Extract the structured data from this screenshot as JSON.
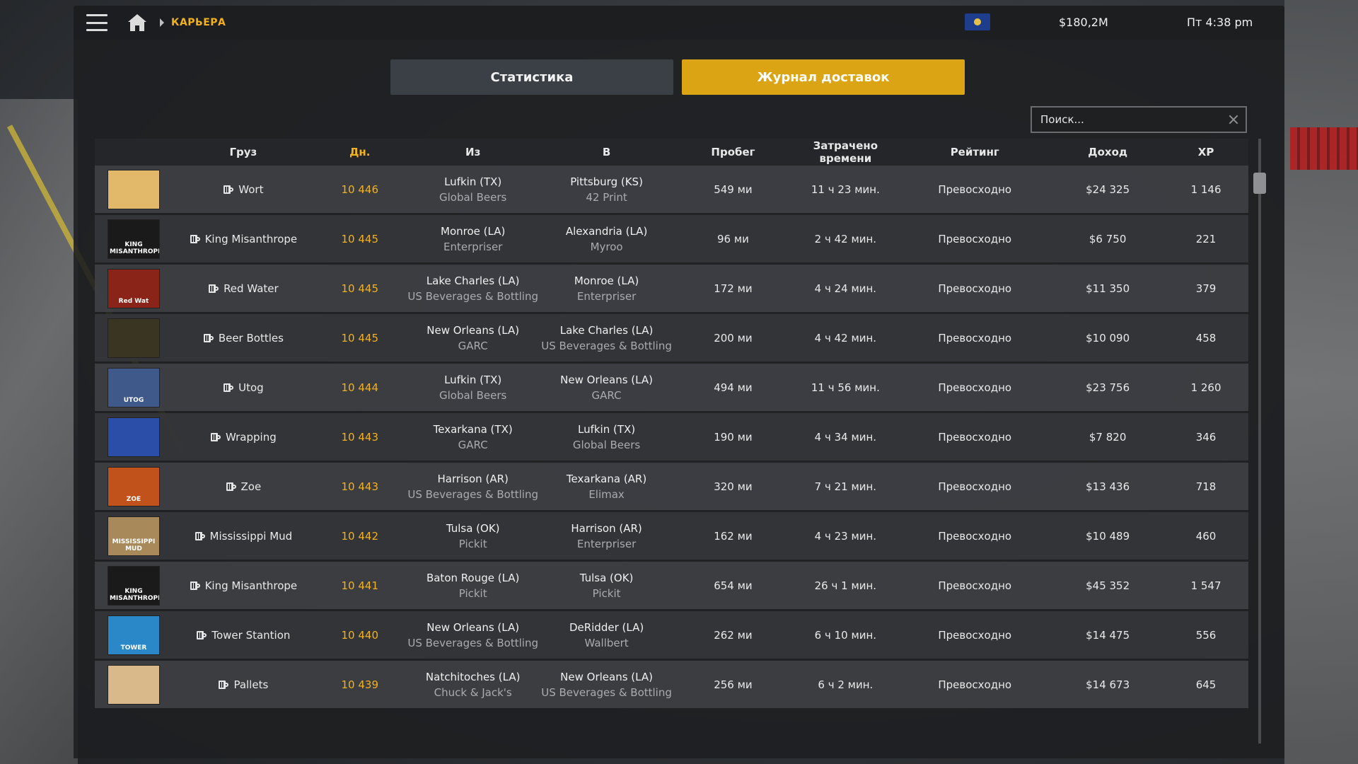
{
  "header": {
    "breadcrumb": "КАРЬЕРА",
    "money": "$180,2M",
    "clock": "Пт 4:38 pm",
    "icons": [
      "hamburger-icon",
      "home-icon",
      "flag-icon"
    ]
  },
  "tabs": [
    {
      "label": "Статистика",
      "active": false
    },
    {
      "label": "Журнал доставок",
      "active": true
    }
  ],
  "search": {
    "placeholder": "Поиск...",
    "value": ""
  },
  "table": {
    "columns": {
      "cargo": "Груз",
      "day": "Дн.",
      "from": "Из",
      "to": "В",
      "distance": "Пробег",
      "time": "Затрачено времени",
      "rating": "Рейтинг",
      "income": "Доход",
      "xp": "XP"
    },
    "rows": [
      {
        "cargo": "Wort",
        "day": "10 446",
        "from_city": "Lufkin (TX)",
        "from_company": "Global Beers",
        "to_city": "Pittsburg (KS)",
        "to_company": "42 Print",
        "distance": "549 ми",
        "time": "11 ч 23 мин.",
        "rating": "Превосходно",
        "income": "$24 325",
        "xp": "1 146",
        "thumb_color": "#e2b86a",
        "thumb_text": ""
      },
      {
        "cargo": "King Misanthrope",
        "day": "10 445",
        "from_city": "Monroe (LA)",
        "from_company": "Enterpriser",
        "to_city": "Alexandria (LA)",
        "to_company": "Myroo",
        "distance": "96 ми",
        "time": "2 ч 42 мин.",
        "rating": "Превосходно",
        "income": "$6 750",
        "xp": "221",
        "thumb_color": "#1a1a1a",
        "thumb_text": "KING MISANTHROPE"
      },
      {
        "cargo": "Red Water",
        "day": "10 445",
        "from_city": "Lake Charles (LA)",
        "from_company": "US Beverages & Bottling",
        "to_city": "Monroe (LA)",
        "to_company": "Enterpriser",
        "distance": "172 ми",
        "time": "4 ч 24 мин.",
        "rating": "Превосходно",
        "income": "$11 350",
        "xp": "379",
        "thumb_color": "#8a2418",
        "thumb_text": "Red Wat"
      },
      {
        "cargo": "Beer Bottles",
        "day": "10 445",
        "from_city": "New Orleans (LA)",
        "from_company": "GARC",
        "to_city": "Lake Charles (LA)",
        "to_company": "US Beverages & Bottling",
        "distance": "200 ми",
        "time": "4 ч 42 мин.",
        "rating": "Превосходно",
        "income": "$10 090",
        "xp": "458",
        "thumb_color": "#3a3522",
        "thumb_text": ""
      },
      {
        "cargo": "Utog",
        "day": "10 444",
        "from_city": "Lufkin (TX)",
        "from_company": "Global Beers",
        "to_city": "New Orleans (LA)",
        "to_company": "GARC",
        "distance": "494 ми",
        "time": "11 ч 56 мин.",
        "rating": "Превосходно",
        "income": "$23 756",
        "xp": "1 260",
        "thumb_color": "#3f5a8a",
        "thumb_text": "UTOG"
      },
      {
        "cargo": "Wrapping",
        "day": "10 443",
        "from_city": "Texarkana (TX)",
        "from_company": "GARC",
        "to_city": "Lufkin (TX)",
        "to_company": "Global Beers",
        "distance": "190 ми",
        "time": "4 ч 34 мин.",
        "rating": "Превосходно",
        "income": "$7 820",
        "xp": "346",
        "thumb_color": "#2b4fa8",
        "thumb_text": ""
      },
      {
        "cargo": "Zoe",
        "day": "10 443",
        "from_city": "Harrison (AR)",
        "from_company": "US Beverages & Bottling",
        "to_city": "Texarkana (AR)",
        "to_company": "Elimax",
        "distance": "320 ми",
        "time": "7 ч 21 мин.",
        "rating": "Превосходно",
        "income": "$13 436",
        "xp": "718",
        "thumb_color": "#c2521c",
        "thumb_text": "ZOE"
      },
      {
        "cargo": "Mississippi Mud",
        "day": "10 442",
        "from_city": "Tulsa (OK)",
        "from_company": "Pickit",
        "to_city": "Harrison (AR)",
        "to_company": "Enterpriser",
        "distance": "162 ми",
        "time": "4 ч 23 мин.",
        "rating": "Превосходно",
        "income": "$10 489",
        "xp": "460",
        "thumb_color": "#a88a5a",
        "thumb_text": "MISSISSIPPI MUD"
      },
      {
        "cargo": "King Misanthrope",
        "day": "10 441",
        "from_city": "Baton Rouge (LA)",
        "from_company": "Pickit",
        "to_city": "Tulsa (OK)",
        "to_company": "Pickit",
        "distance": "654 ми",
        "time": "26 ч 1 мин.",
        "rating": "Превосходно",
        "income": "$45 352",
        "xp": "1 547",
        "thumb_color": "#1a1a1a",
        "thumb_text": "KING MISANTHROPE"
      },
      {
        "cargo": "Tower Stantion",
        "day": "10 440",
        "from_city": "New Orleans (LA)",
        "from_company": "US Beverages & Bottling",
        "to_city": "DeRidder (LA)",
        "to_company": "Wallbert",
        "distance": "262 ми",
        "time": "6 ч 10 мин.",
        "rating": "Превосходно",
        "income": "$14 475",
        "xp": "556",
        "thumb_color": "#2a88c8",
        "thumb_text": "TOWER"
      },
      {
        "cargo": "Pallets",
        "day": "10 439",
        "from_city": "Natchitoches (LA)",
        "from_company": "Chuck & Jack's",
        "to_city": "New Orleans (LA)",
        "to_company": "US Beverages & Bottling",
        "distance": "256 ми",
        "time": "6 ч 2 мин.",
        "rating": "Превосходно",
        "income": "$14 673",
        "xp": "645",
        "thumb_color": "#d9b98a",
        "thumb_text": ""
      }
    ]
  },
  "colors": {
    "accent": "#f2b21e",
    "tab_active": "#dba414",
    "tab_inactive": "#3b4047"
  }
}
